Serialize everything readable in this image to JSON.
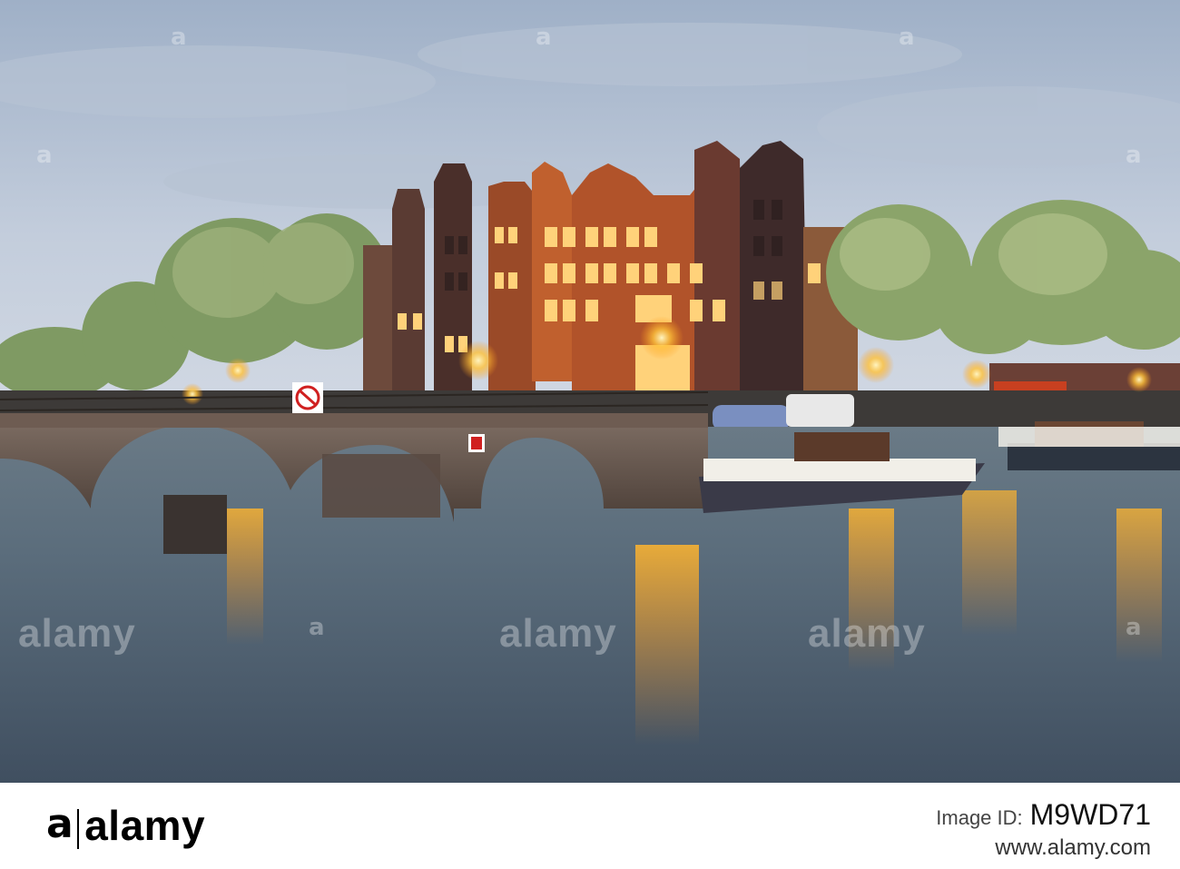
{
  "photo": {
    "subject": "Amsterdam canal houses and arched stone bridge at dusk with moored houseboats"
  },
  "watermark": {
    "word": "alamy",
    "mark": "a"
  },
  "footer": {
    "logo_mark": "a",
    "logo_word": "alamy",
    "image_id_label": "Image ID:",
    "image_id": "M9WD71",
    "url": "www.alamy.com"
  },
  "colors": {
    "sky_top": "#a6b6cb",
    "sky_bottom": "#cbd4e0",
    "water": "#566878",
    "lamp_glow": "#ffc23a",
    "brick": "#a8502e",
    "footer_bg": "#ffffff",
    "footer_text": "#000000"
  }
}
